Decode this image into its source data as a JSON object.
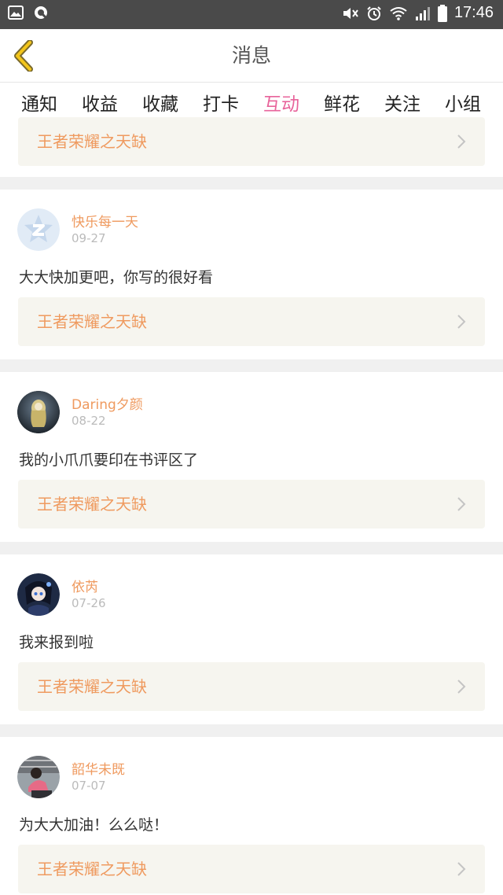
{
  "status_bar": {
    "time": "17:46"
  },
  "header": {
    "title": "消息"
  },
  "tabs": [
    {
      "label": "通知"
    },
    {
      "label": "收益"
    },
    {
      "label": "收藏"
    },
    {
      "label": "打卡"
    },
    {
      "label": "互动",
      "active": true
    },
    {
      "label": "鲜花"
    },
    {
      "label": "关注"
    },
    {
      "label": "小组"
    }
  ],
  "messages": [
    {
      "book": "王者荣耀之天缺"
    },
    {
      "user": "快乐每一天",
      "date": "09-27",
      "comment": "大大快加更吧，你写的很好看",
      "book": "王者荣耀之天缺"
    },
    {
      "user": "Daring夕颜",
      "date": "08-22",
      "comment": "我的小爪爪要印在书评区了",
      "book": "王者荣耀之天缺"
    },
    {
      "user": "依芮",
      "date": "07-26",
      "comment": "我来报到啦",
      "book": "王者荣耀之天缺"
    },
    {
      "user": "韶华未既",
      "date": "07-07",
      "comment": "为大大加油！么么哒！",
      "book": "王者荣耀之天缺"
    }
  ],
  "colors": {
    "accent": "#e8649b",
    "username": "#ef9a5f",
    "book_bg": "#f6f5ef"
  }
}
